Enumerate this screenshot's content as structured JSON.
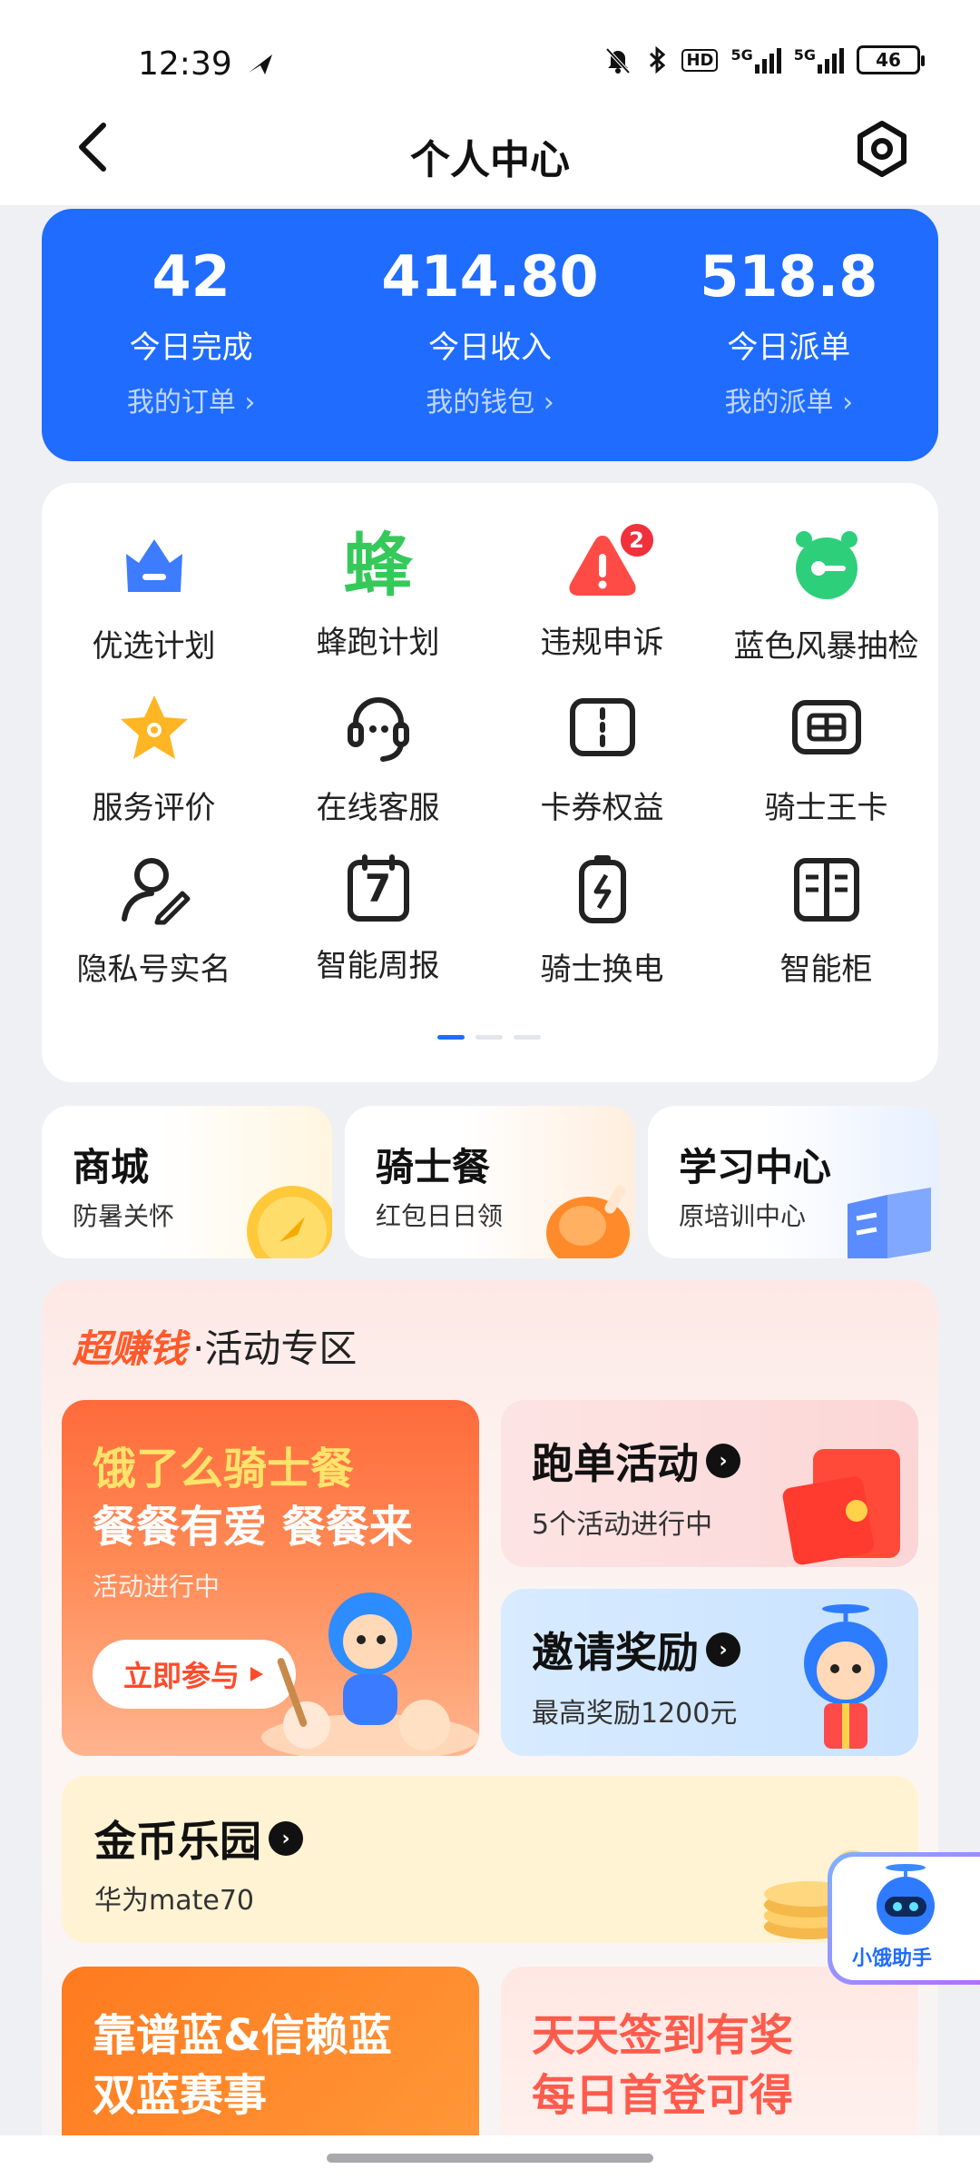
{
  "status_bar": {
    "time": "12:39",
    "hd_label": "HD",
    "sim1": "5G",
    "sim2": "5G",
    "battery": "46"
  },
  "header": {
    "title": "个人中心"
  },
  "stats": [
    {
      "value": "42",
      "label": "今日完成",
      "link": "我的订单 ›"
    },
    {
      "value": "414.80",
      "label": "今日收入",
      "link": "我的钱包 ›"
    },
    {
      "value": "518.8",
      "label": "今日派单",
      "link": "我的派单 ›"
    }
  ],
  "grid": [
    {
      "label": "优选计划",
      "icon": "crown-icon"
    },
    {
      "label": "蜂跑计划",
      "icon": "bee-icon",
      "icon_text": "蜂"
    },
    {
      "label": "违规申诉",
      "icon": "alert-icon",
      "badge": "2"
    },
    {
      "label": "蓝色风暴抽检",
      "icon": "key-alarm-icon"
    },
    {
      "label": "服务评价",
      "icon": "star-icon"
    },
    {
      "label": "在线客服",
      "icon": "headset-icon"
    },
    {
      "label": "卡券权益",
      "icon": "coupon-icon"
    },
    {
      "label": "骑士王卡",
      "icon": "sim-card-icon"
    },
    {
      "label": "隐私号实名",
      "icon": "user-edit-icon"
    },
    {
      "label": "智能周报",
      "icon": "calendar-icon",
      "icon_text": "7"
    },
    {
      "label": "骑士换电",
      "icon": "battery-swap-icon"
    },
    {
      "label": "智能柜",
      "icon": "locker-icon"
    }
  ],
  "mini_cards": [
    {
      "title": "商城",
      "subtitle": "防暑关怀"
    },
    {
      "title": "骑士餐",
      "subtitle": "红包日日领"
    },
    {
      "title": "学习中心",
      "subtitle": "原培训中心"
    }
  ],
  "activity": {
    "brand": "超赚钱",
    "title": "·活动专区",
    "hero": {
      "line1": "饿了么骑士餐",
      "line2": "餐餐有爱 餐餐来",
      "line3": "活动进行中",
      "button": "立即参与"
    },
    "run_orders": {
      "title": "跑单活动",
      "subtitle": "5个活动进行中"
    },
    "invite": {
      "title": "邀请奖励",
      "subtitle": "最高奖励1200元"
    },
    "coins": {
      "title": "金币乐园",
      "subtitle": "华为mate70"
    },
    "promo_left": {
      "line1": "靠谱蓝&信赖蓝",
      "line2": "双蓝赛事"
    },
    "promo_right": {
      "line1": "天天签到有奖",
      "line2": "每日首登可得"
    }
  },
  "assistant": {
    "label": "小饿助手"
  },
  "colors": {
    "primary": "#1f6cff",
    "accent": "#ff5a2c",
    "badge": "#f0313b"
  }
}
